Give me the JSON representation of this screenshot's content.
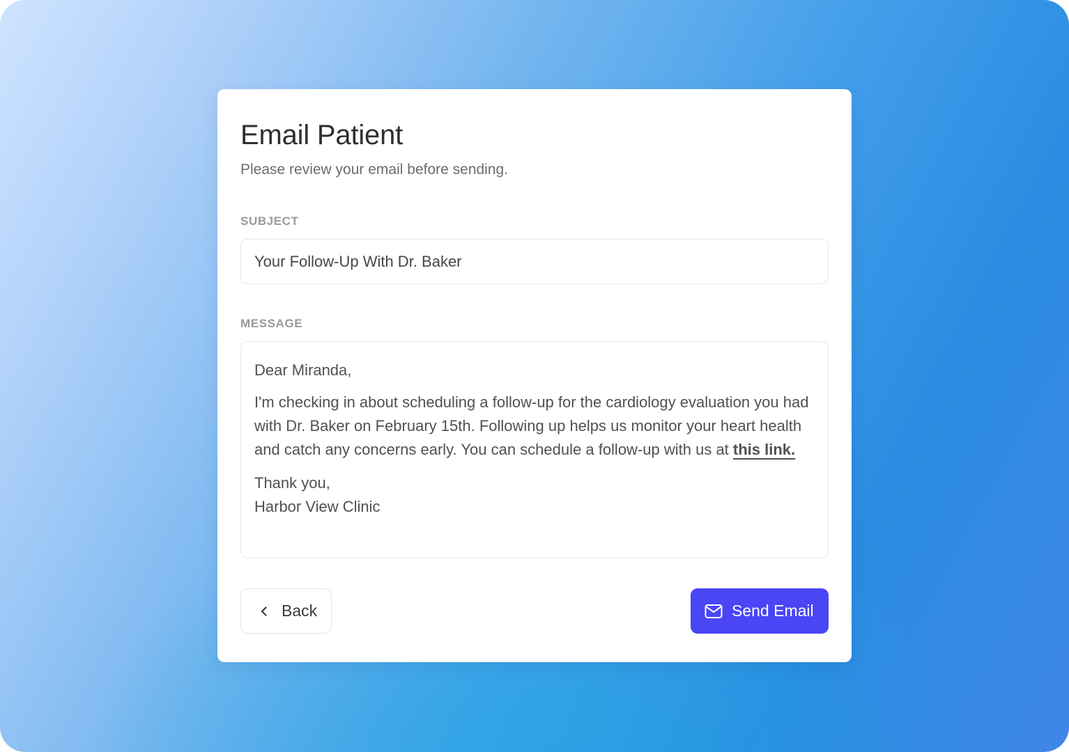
{
  "dialog": {
    "title": "Email Patient",
    "subtitle": "Please review your email before sending."
  },
  "subject": {
    "label": "SUBJECT",
    "value": "Your Follow-Up With Dr. Baker"
  },
  "message": {
    "label": "MESSAGE",
    "greeting": "Dear Miranda,",
    "body": "I'm checking in about scheduling a follow-up for the cardiology evaluation you had with Dr. Baker on February 15th. Following up helps us monitor your heart health and catch any concerns early. You can schedule a follow-up with us at ",
    "link_text": "this link.",
    "closing": "Thank you,",
    "signature": "Harbor View Clinic"
  },
  "actions": {
    "back_label": "Back",
    "back_icon": "chevron-left-icon",
    "send_label": "Send Email",
    "send_icon": "mail-icon"
  },
  "colors": {
    "primary_button": "#4a45f5",
    "background_gradient_start": "#cfe4ff",
    "background_gradient_end": "#2a8ce2"
  }
}
